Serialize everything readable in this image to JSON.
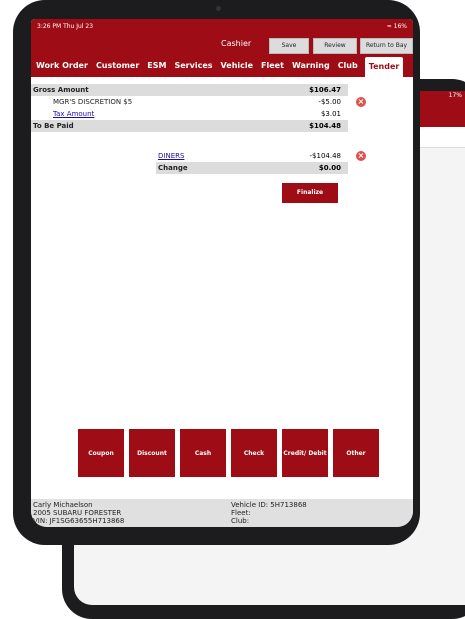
{
  "status": {
    "time": "3:26 PM  Thu Jul 23",
    "battery": "16%"
  },
  "back_status": {
    "battery": "17%"
  },
  "header": {
    "title": "Cashier",
    "save": "Save",
    "review": "Review",
    "return_to_bay": "Return to Bay"
  },
  "tabs": [
    "Work Order",
    "Customer",
    "ESM",
    "Services",
    "Vehicle",
    "Fleet",
    "Warning",
    "Club",
    "Tender"
  ],
  "summary": {
    "gross_label": "Gross Amount",
    "gross_value": "$106.47",
    "discount_label": "MGR'S DISCRETION $5",
    "discount_value": "-$5.00",
    "tax_label": "Tax Amount",
    "tax_value": "$3.01",
    "tbp_label": "To Be Paid",
    "tbp_value": "$104.48"
  },
  "payment": {
    "method": "DINERS",
    "amount": "-$104.48",
    "change_label": "Change",
    "change_value": "$0.00"
  },
  "finalize": "Finalize",
  "actions": [
    "Coupon",
    "Discount",
    "Cash",
    "Check",
    "Credit/ Debit",
    "Other"
  ],
  "footer": {
    "customer": "Carly Michaelson",
    "vehicle": "2005 SUBARU FORESTER",
    "vin": "VIN: JF1SG63655H713868",
    "vehicle_id": "Vehicle ID: 5H713868",
    "fleet": "Fleet:",
    "club": "Club:"
  },
  "colors": {
    "brand": "#9e0d16",
    "shade": "#dcdcdc",
    "link": "#1a0dab"
  }
}
